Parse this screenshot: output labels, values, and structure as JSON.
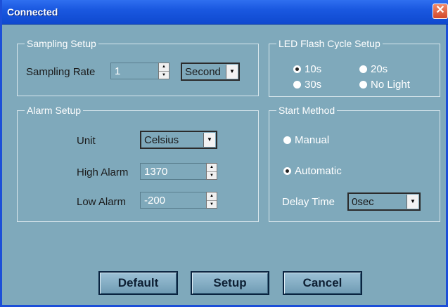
{
  "window": {
    "title": "Connected",
    "close_icon": "close-icon"
  },
  "sampling": {
    "group_title": "Sampling Setup",
    "rate_label": "Sampling Rate",
    "rate_value": "1",
    "unit_value": "Second"
  },
  "led": {
    "group_title": "LED Flash Cycle Setup",
    "options": [
      {
        "label": "10s",
        "selected": true
      },
      {
        "label": "20s",
        "selected": false
      },
      {
        "label": "30s",
        "selected": false
      },
      {
        "label": "No Light",
        "selected": false
      }
    ]
  },
  "alarm": {
    "group_title": "Alarm Setup",
    "unit_label": "Unit",
    "unit_value": "Celsius",
    "high_label": "High Alarm",
    "high_value": "1370",
    "low_label": "Low Alarm",
    "low_value": "-200"
  },
  "start": {
    "group_title": "Start Method",
    "manual_label": "Manual",
    "manual_selected": false,
    "automatic_label": "Automatic",
    "automatic_selected": true,
    "delay_label": "Delay Time",
    "delay_value": "0sec"
  },
  "buttons": {
    "default_label": "Default",
    "setup_label": "Setup",
    "cancel_label": "Cancel"
  }
}
